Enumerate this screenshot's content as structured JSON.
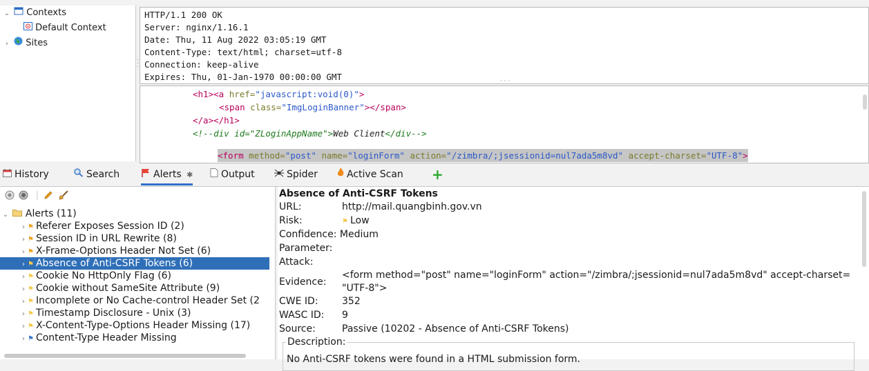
{
  "tree": {
    "contexts": "Contexts",
    "default_context": "Default Context",
    "sites": "Sites"
  },
  "response_headers": [
    "HTTP/1.1 200 OK",
    "Server: nginx/1.16.1",
    "Date: Thu, 11 Aug 2022 03:05:19 GMT",
    "Content-Type: text/html; charset=utf-8",
    "Connection: keep-alive",
    "Expires: Thu, 01-Jan-1970 00:00:00 GMT"
  ],
  "body": {
    "l1_tag1": "<h1>",
    "l1_tag2": "<a ",
    "l1_attr": "href=",
    "l1_val": "\"javascript:void(0)\"",
    "l1_close": ">",
    "l2_tag": "<span ",
    "l2_attr": "class=",
    "l2_val": "\"ImgLoginBanner\"",
    "l2_close": "></span>",
    "l3": "</a></h1>",
    "l4_a": "<!--div id=\"ZLoginAppName\">",
    "l4_b": "Web Client",
    "l4_c": "</div-->",
    "l5_tag": "<form ",
    "l5_a1": "method=",
    "l5_v1": "\"post\"",
    "l5_a2": " name=",
    "l5_v2": "\"loginForm\"",
    "l5_a3": " action=",
    "l5_v3": "\"/zimbra/;jsessionid=nul7ada5m8vd\"",
    "l5_a4": " accept-charset=",
    "l5_v4": "\"UTF-8\"",
    "l5_close": ">"
  },
  "tabs": [
    {
      "label": "History",
      "icon": "history-icon"
    },
    {
      "label": "Search",
      "icon": "search-icon"
    },
    {
      "label": "Alerts",
      "icon": "alerts-flag-icon"
    },
    {
      "label": "Output",
      "icon": "output-icon"
    },
    {
      "label": "Spider",
      "icon": "spider-icon"
    },
    {
      "label": "Active Scan",
      "icon": "active-scan-icon"
    }
  ],
  "alerts": {
    "root": "Alerts (11)",
    "items": [
      {
        "label": "Referer Exposes Session ID (2)",
        "risk": "medium"
      },
      {
        "label": "Session ID in URL Rewrite (8)",
        "risk": "medium"
      },
      {
        "label": "X-Frame-Options Header Not Set (6)",
        "risk": "medium"
      },
      {
        "label": "Absence of Anti-CSRF Tokens (6)",
        "risk": "low"
      },
      {
        "label": "Cookie No HttpOnly Flag (6)",
        "risk": "low"
      },
      {
        "label": "Cookie without SameSite Attribute (9)",
        "risk": "low"
      },
      {
        "label": "Incomplete or No Cache-control Header Set (2",
        "risk": "low"
      },
      {
        "label": "Timestamp Disclosure - Unix (3)",
        "risk": "low"
      },
      {
        "label": "X-Content-Type-Options Header Missing (17)",
        "risk": "low"
      },
      {
        "label": "Content-Type Header Missing",
        "risk": "info"
      }
    ]
  },
  "detail": {
    "title": "Absence of Anti-CSRF Tokens",
    "url_label": "URL:",
    "url": "http://mail.quangbinh.gov.vn",
    "risk_label": "Risk:",
    "risk": "Low",
    "confidence_label": "Confidence:",
    "confidence": "Medium",
    "parameter_label": "Parameter:",
    "attack_label": "Attack:",
    "evidence_label": "Evidence:",
    "evidence_1": "<form method=\"post\" name=\"loginForm\" action=\"/zimbra/;jsessionid=nul7ada5m8vd\" accept-charset=",
    "evidence_2": "\"UTF-8\">",
    "cwe_label": "CWE ID:",
    "cwe": "352",
    "wasc_label": "WASC ID:",
    "wasc": "9",
    "source_label": "Source:",
    "source": "Passive (10202 - Absence of Anti-CSRF Tokens)",
    "description_label": "Description:",
    "description": "No Anti-CSRF tokens were found in a HTML submission form."
  },
  "colors": {
    "selection": "#2f6fb8",
    "tab_underline": "#2f6fcb",
    "flag_medium": "#f0a020",
    "flag_low": "#f2c94c",
    "flag_info": "#3a7bd5",
    "tag": "#b8005a",
    "attr_value": "#2a58c7"
  }
}
